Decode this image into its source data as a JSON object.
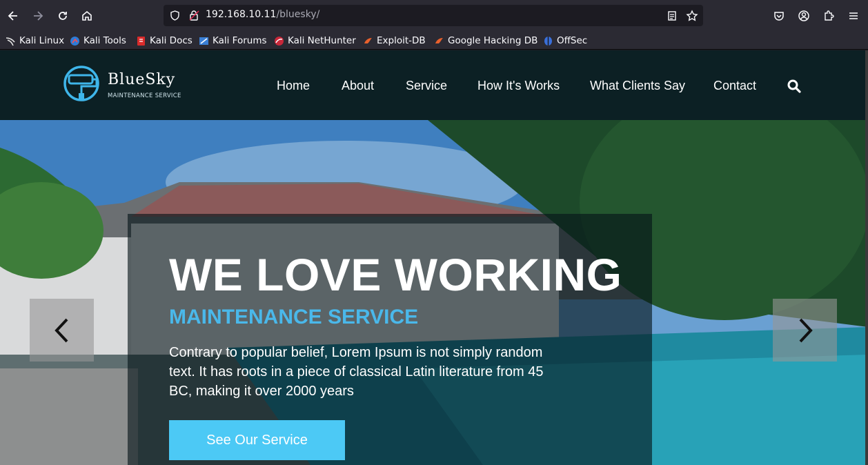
{
  "browser": {
    "url_host": "192.168.10.11",
    "url_path": "/bluesky/",
    "bookmarks": [
      {
        "label": "Kali Linux",
        "icon": "kali-dragon-icon"
      },
      {
        "label": "Kali Tools",
        "icon": "kali-tools-icon"
      },
      {
        "label": "Kali Docs",
        "icon": "kali-docs-icon"
      },
      {
        "label": "Kali Forums",
        "icon": "kali-forums-icon"
      },
      {
        "label": "Kali NetHunter",
        "icon": "nethunter-icon"
      },
      {
        "label": "Exploit-DB",
        "icon": "exploitdb-icon"
      },
      {
        "label": "Google Hacking DB",
        "icon": "ghdb-icon"
      },
      {
        "label": "OffSec",
        "icon": "offsec-icon"
      }
    ]
  },
  "site": {
    "logo_name": "BlueSky",
    "logo_sub": "MAINTENANCE SERVICE",
    "nav": [
      "Home",
      "About",
      "Service",
      "How It's Works",
      "What Clients Say",
      "Contact"
    ]
  },
  "hero": {
    "title": "WE LOVE WORKING",
    "subtitle": "MAINTENANCE SERVICE",
    "text": "Contrary to popular belief, Lorem Ipsum is not simply random text. It has roots in a piece of classical Latin literature from 45 BC, making it over 2000 years",
    "cta": "See Our Service"
  },
  "colors": {
    "nav_bg": "#0c2024",
    "accent": "#4ab8ea",
    "button": "#4cc9f5"
  }
}
